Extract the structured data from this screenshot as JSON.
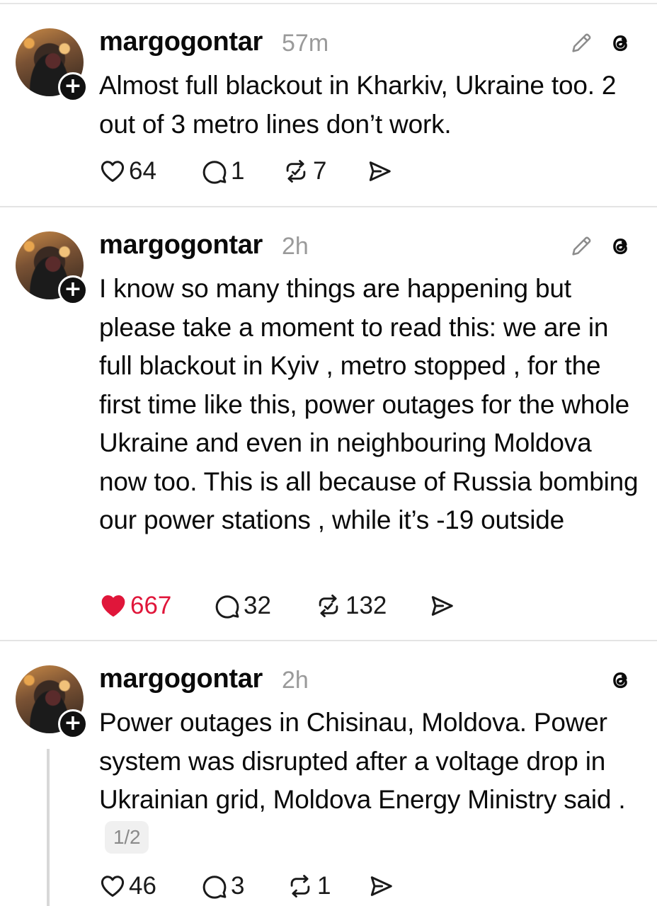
{
  "posts": [
    {
      "username": "margogontar",
      "time": "57m",
      "text": "Almost full blackout in Kharkiv, Ukraine too. 2 out of 3 metro lines don’t work.",
      "likes": "64",
      "replies": "1",
      "reposts": "7",
      "liked": false,
      "editable": true
    },
    {
      "username": "margogontar",
      "time": "2h",
      "text": "I know so many things are happening but please take a moment to read this: we are in full blackout in Kyiv , metro stopped , for the first time like this, power outages for the whole Ukraine and even in neighbouring Moldova now too. This is all because of Russia bombing our power stations , while it’s -19 outside",
      "likes": "667",
      "replies": "32",
      "reposts": "132",
      "liked": true,
      "editable": true
    },
    {
      "username": "margogontar",
      "time": "2h",
      "text": "Power outages in Chisinau, Moldova. Power system was disrupted after a voltage drop in Ukrainian grid, Moldova Energy Ministry said .",
      "page_badge": "1/2",
      "likes": "46",
      "replies": "3",
      "reposts": "1",
      "liked": false,
      "editable": false
    }
  ],
  "icons": {
    "like": "heart-icon",
    "reply": "speech-bubble-icon",
    "repost": "repost-icon",
    "share": "send-icon",
    "edit": "pencil-icon",
    "brand": "threads-logo-icon",
    "follow": "plus-icon"
  },
  "colors": {
    "liked": "#e0163a",
    "text": "#0a0a0a",
    "muted": "#9a9a9a"
  }
}
